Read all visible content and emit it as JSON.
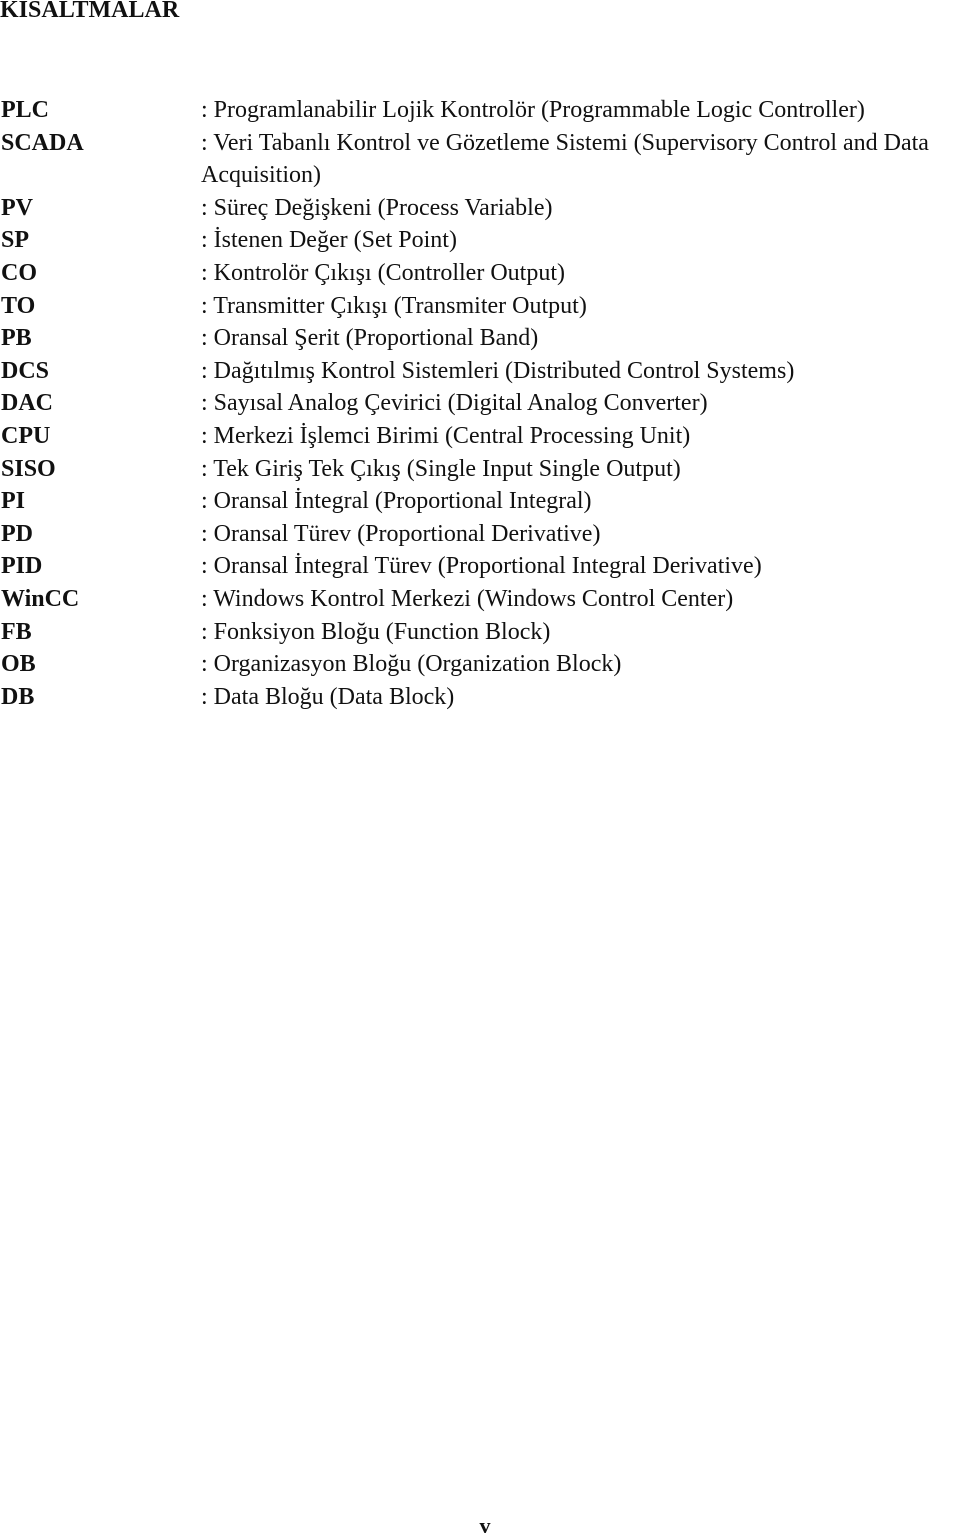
{
  "page": {
    "title": "KISALTMALAR",
    "page_number": "v"
  },
  "abbreviations": [
    {
      "term": "PLC",
      "definition": ": Programlanabilir Lojik Kontrolör (Programmable Logic Controller)"
    },
    {
      "term": "SCADA",
      "definition": ": Veri Tabanlı Kontrol ve Gözetleme Sistemi (Supervisory Control and Data Acquisition)"
    },
    {
      "term": "PV",
      "definition": ": Süreç Değişkeni (Process Variable)"
    },
    {
      "term": "SP",
      "definition": ": İstenen Değer (Set Point)"
    },
    {
      "term": "CO",
      "definition": ": Kontrolör Çıkışı (Controller Output)"
    },
    {
      "term": "TO",
      "definition": ": Transmitter Çıkışı (Transmiter Output)"
    },
    {
      "term": "PB",
      "definition": ": Oransal Şerit (Proportional Band)"
    },
    {
      "term": "DCS",
      "definition": ": Dağıtılmış Kontrol Sistemleri (Distributed Control Systems)"
    },
    {
      "term": "DAC",
      "definition": ": Sayısal Analog Çevirici (Digital Analog Converter)"
    },
    {
      "term": "CPU",
      "definition": ": Merkezi İşlemci Birimi (Central Processing Unit)"
    },
    {
      "term": "SISO",
      "definition": ": Tek Giriş Tek Çıkış (Single Input Single Output)"
    },
    {
      "term": "PI",
      "definition": ": Oransal İntegral (Proportional Integral)"
    },
    {
      "term": "PD",
      "definition": ": Oransal Türev (Proportional Derivative)"
    },
    {
      "term": "PID",
      "definition": ": Oransal İntegral Türev (Proportional Integral Derivative)"
    },
    {
      "term": "WinCC",
      "definition": ": Windows Kontrol Merkezi (Windows Control Center)"
    },
    {
      "term": "FB",
      "definition": ": Fonksiyon Bloğu (Function Block)"
    },
    {
      "term": "OB",
      "definition": ": Organizasyon Bloğu (Organization Block)"
    },
    {
      "term": "DB",
      "definition": ": Data Bloğu (Data Block)"
    }
  ]
}
